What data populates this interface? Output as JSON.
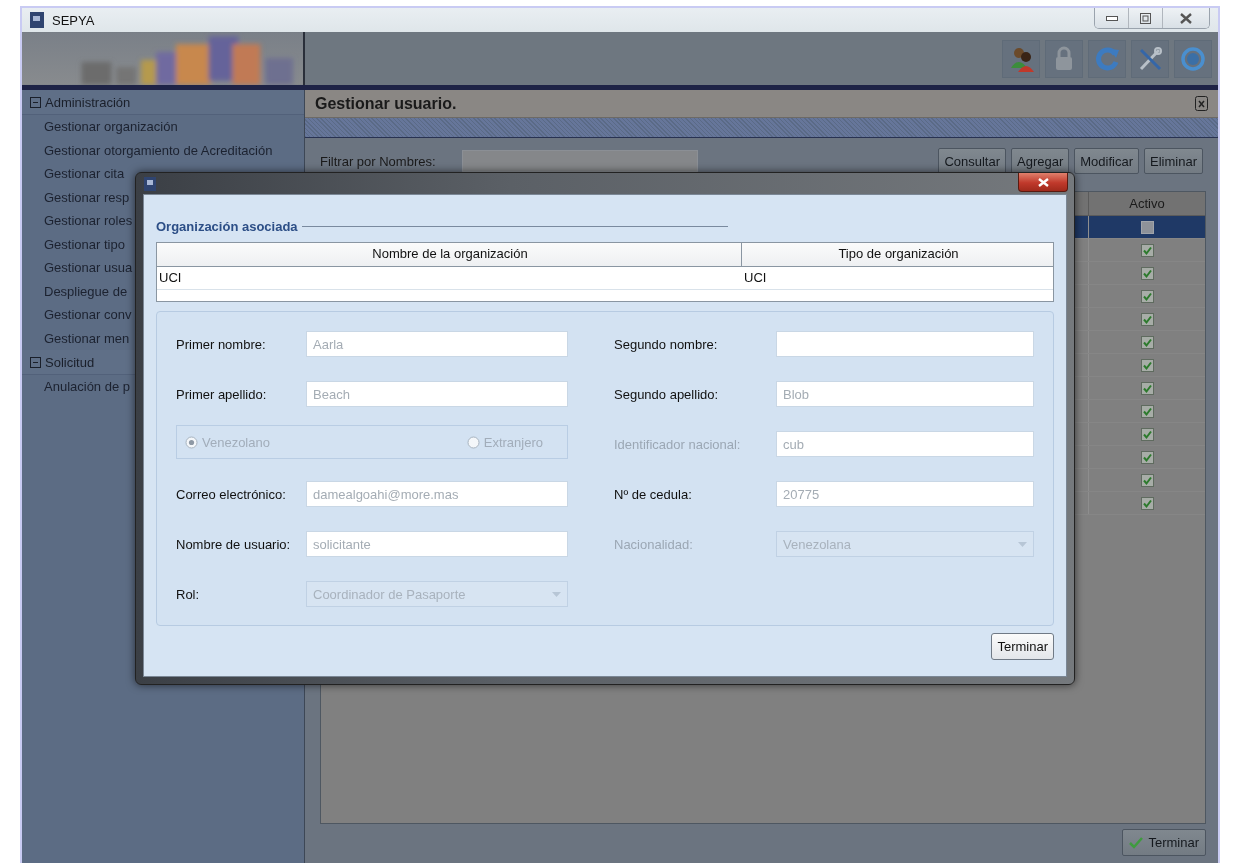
{
  "window": {
    "title": "SEPYA"
  },
  "sidebar": {
    "sections": [
      {
        "label": "Administración",
        "expanded": true,
        "items": [
          "Gestionar organización",
          "Gestionar otorgamiento de Acreditación",
          "Gestionar cita",
          "Gestionar resp",
          "Gestionar roles",
          "Gestionar tipo",
          "Gestionar usua",
          "Despliegue de",
          "Gestionar conv",
          "Gestionar men"
        ]
      },
      {
        "label": "Solicitud",
        "expanded": true,
        "items": [
          "Anulación de p"
        ]
      }
    ]
  },
  "main": {
    "title": "Gestionar usuario.",
    "filter": {
      "label": "Filtrar por Nombres:"
    },
    "buttons": [
      "Consultar",
      "Agregar",
      "Modificar",
      "Eliminar"
    ],
    "table": {
      "columns": [
        "Activo"
      ],
      "rows": [
        {
          "activo": false,
          "selected": true
        },
        {
          "activo": true,
          "selected": false
        },
        {
          "activo": true,
          "selected": false
        },
        {
          "activo": true,
          "selected": false
        },
        {
          "activo": true,
          "selected": false
        },
        {
          "activo": true,
          "selected": false
        },
        {
          "activo": true,
          "selected": false
        },
        {
          "activo": true,
          "selected": false
        },
        {
          "activo": true,
          "selected": false
        },
        {
          "activo": true,
          "selected": false
        },
        {
          "activo": true,
          "selected": false
        },
        {
          "activo": true,
          "selected": false
        },
        {
          "activo": true,
          "selected": false
        }
      ]
    },
    "finish_button": "Terminar"
  },
  "dialog": {
    "group_title": "Organización asociada",
    "org_table": {
      "columns": [
        "Nombre de la organización",
        "Tipo de organización"
      ],
      "rows": [
        [
          "UCI",
          "UCI"
        ]
      ]
    },
    "fields": [
      {
        "kind": "text",
        "label": "Primer nombre:",
        "value": "Aarla",
        "disabled": false
      },
      {
        "kind": "text",
        "label": "Segundo nombre:",
        "disabled": false
      },
      {
        "kind": "text",
        "label": "Primer apellido:",
        "value": "Beach",
        "disabled": false
      },
      {
        "kind": "text",
        "label": "Segundo apellido:",
        "value": "Blob",
        "disabled": false
      },
      {
        "kind": "radio",
        "disabled": true,
        "options": [
          {
            "label": "Venezolano",
            "selected": true
          },
          {
            "label": "Extranjero",
            "selected": false
          }
        ]
      },
      {
        "kind": "text",
        "label": "Identificador nacional:",
        "value": "cub",
        "disabled": true
      },
      {
        "kind": "text",
        "label": "Correo electrónico:",
        "value": "damealgoahi@more.mas",
        "disabled": false
      },
      {
        "kind": "text",
        "label": "Nº de cedula:",
        "value": "20775",
        "disabled": false
      },
      {
        "kind": "text",
        "label": "Nombre de usuario:",
        "value": "solicitante",
        "disabled": false
      },
      {
        "kind": "combo",
        "label": "Nacionalidad:",
        "value": "Venezolana",
        "disabled": true
      },
      {
        "kind": "combo",
        "label": "Rol:",
        "value": "Coordinador de Pasaporte",
        "disabled": false
      }
    ],
    "finish_button": "Terminar"
  }
}
